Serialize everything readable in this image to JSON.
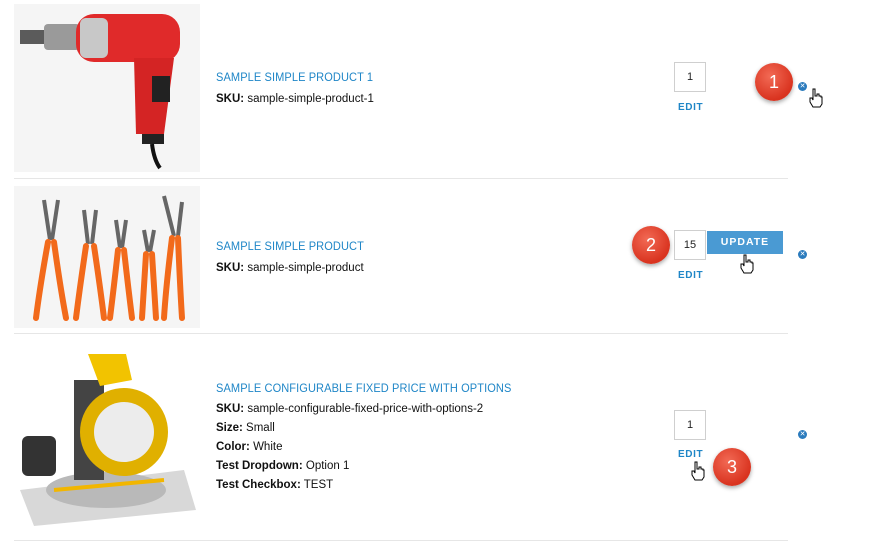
{
  "cart": {
    "items": [
      {
        "name": "SAMPLE SIMPLE PRODUCT 1",
        "sku_label": "SKU:",
        "sku": "sample-simple-product-1",
        "qty": "1",
        "edit_label": "EDIT"
      },
      {
        "name": "SAMPLE SIMPLE PRODUCT",
        "sku_label": "SKU:",
        "sku": "sample-simple-product",
        "qty": "15",
        "edit_label": "EDIT",
        "update_label": "UPDATE"
      },
      {
        "name": "SAMPLE CONFIGURABLE FIXED PRICE WITH OPTIONS",
        "sku_label": "SKU:",
        "sku": "sample-configurable-fixed-price-with-options-2",
        "options": [
          {
            "label": "Size:",
            "value": "Small"
          },
          {
            "label": "Color:",
            "value": "White"
          },
          {
            "label": "Test Dropdown:",
            "value": "Option 1"
          },
          {
            "label": "Test Checkbox:",
            "value": "TEST"
          }
        ],
        "qty": "1",
        "edit_label": "EDIT"
      }
    ]
  },
  "annotations": [
    "1",
    "2",
    "3"
  ],
  "colors": {
    "link": "#1f86c7",
    "update_button": "#4a9ad3",
    "remove_icon": "#2b7bbd",
    "annotation_badge": "#d9331f"
  },
  "icons": [
    "remove-icon",
    "hand-cursor-icon"
  ]
}
